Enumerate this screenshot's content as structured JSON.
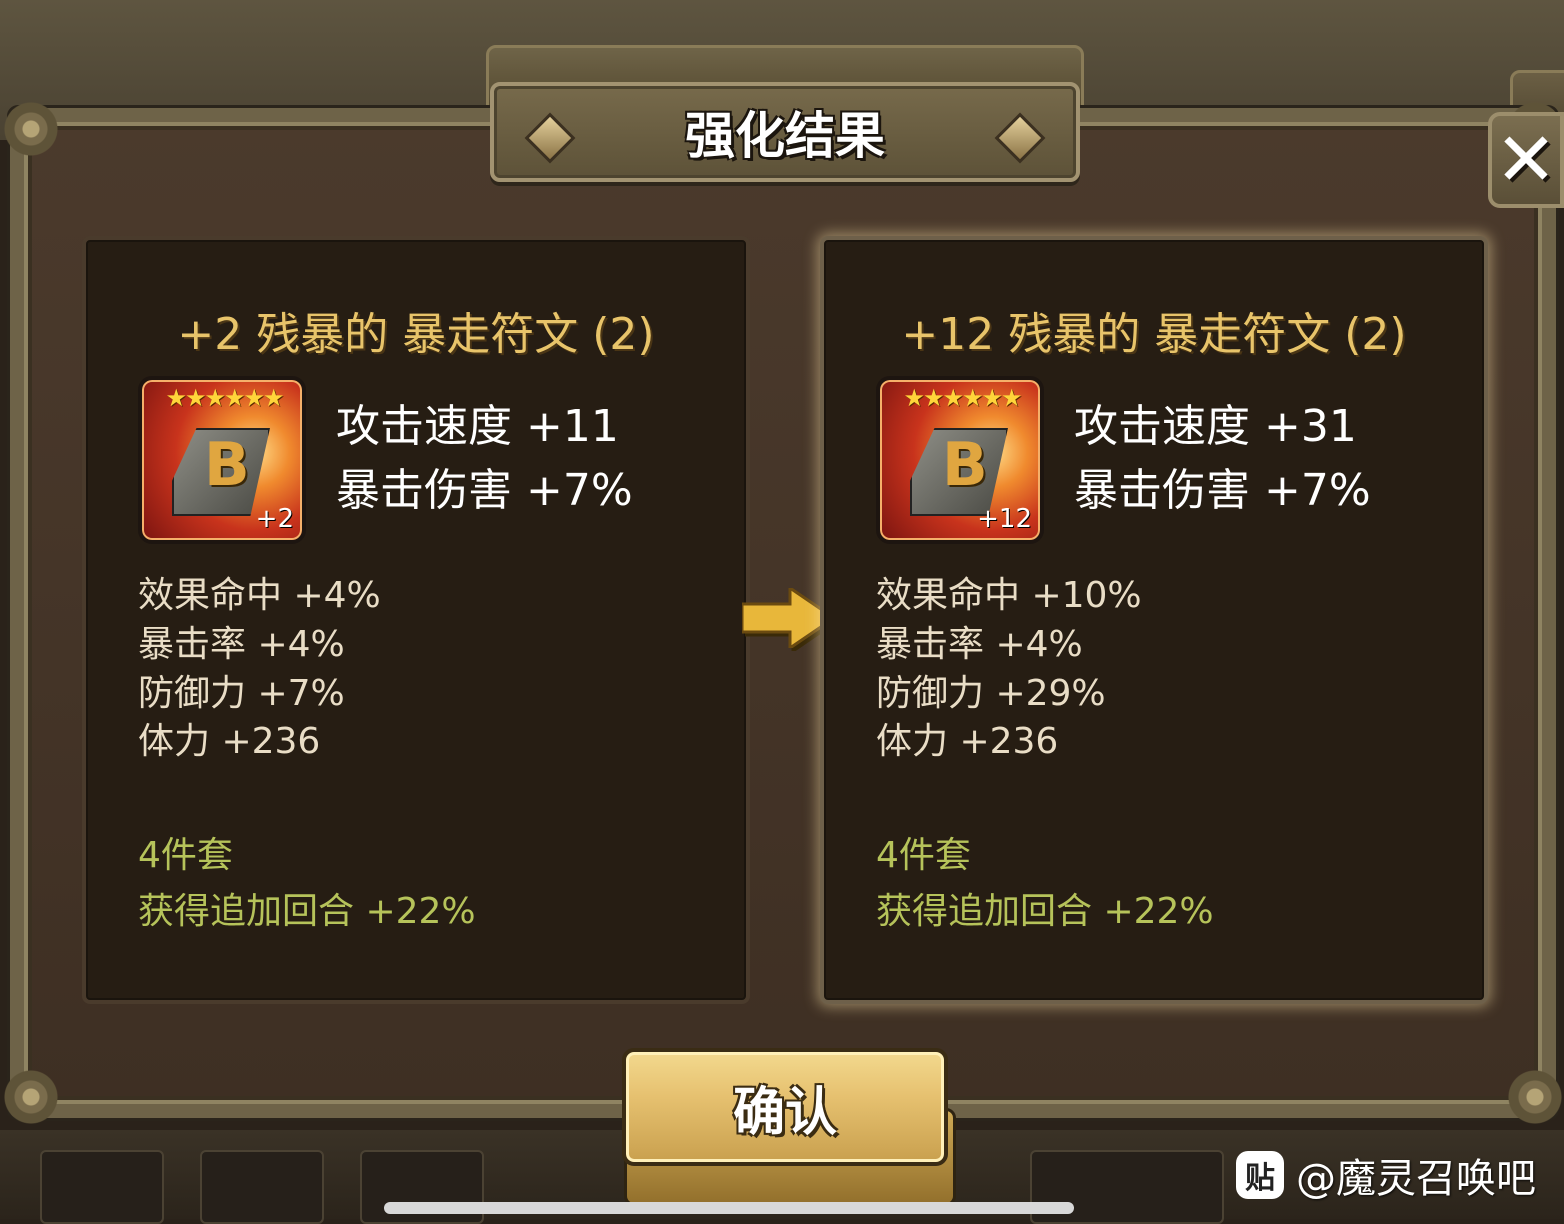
{
  "dialog": {
    "title": "强化结果",
    "close_label": "✕",
    "confirm_label": "确认"
  },
  "before": {
    "title": "+2 残暴的 暴走符文 (2)",
    "stars": "★★★★★★",
    "rune_glyph": "B",
    "level_badge": "+2",
    "main_stats": [
      "攻击速度 +11",
      "暴击伤害 +7%"
    ],
    "sub_stats": [
      "效果命中 +4%",
      "暴击率 +4%",
      "防御力 +7%",
      "体力 +236"
    ],
    "set_name": "4件套",
    "set_effect": "获得追加回合 +22%"
  },
  "after": {
    "title": "+12 残暴的 暴走符文 (2)",
    "stars": "★★★★★★",
    "rune_glyph": "B",
    "level_badge": "+12",
    "main_stats": [
      "攻击速度 +31",
      "暴击伤害 +7%"
    ],
    "sub_stats": [
      "效果命中 +10%",
      "暴击率 +4%",
      "防御力 +29%",
      "体力 +236"
    ],
    "set_name": "4件套",
    "set_effect": "获得追加回合 +22%"
  },
  "watermark": {
    "icon": "贴",
    "text": "@魔灵召唤吧"
  },
  "colors": {
    "title_gold": "#e8c46a",
    "set_green": "#b6c35a",
    "button_gold": "#e6c170"
  }
}
